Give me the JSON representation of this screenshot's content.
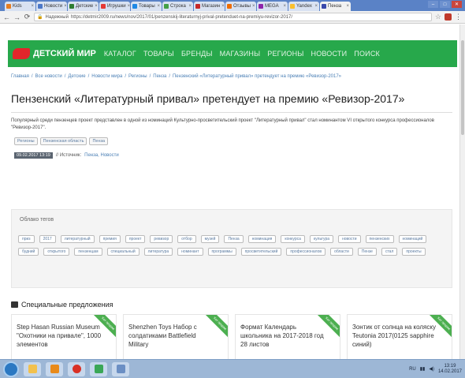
{
  "browser": {
    "tabs": [
      {
        "label": "Kids",
        "color": "#e67e22"
      },
      {
        "label": "Новости",
        "color": "#4c78c8"
      },
      {
        "label": "Детские",
        "color": "#2e7d32"
      },
      {
        "label": "Игрушки",
        "color": "#e53935"
      },
      {
        "label": "Товары",
        "color": "#1e88e5"
      },
      {
        "label": "Строка",
        "color": "#43a047"
      },
      {
        "label": "Магазин",
        "color": "#c62828"
      },
      {
        "label": "Отзывы",
        "color": "#ef6c00"
      },
      {
        "label": "MEGA",
        "color": "#8e24aa"
      },
      {
        "label": "Yandex",
        "color": "#fbc02d"
      },
      {
        "label": "Пенза",
        "color": "#3949ab"
      }
    ],
    "url_prefix": "Надежный",
    "url": "https://detmir2009.ru/news/nov/2017/01/penzenskij-literaturnyj-prival-pretenduet-na-premiyu-revizor-2017/",
    "menu_icon": "⋮"
  },
  "site": {
    "logo": "ДЕТСКИЙ МИР",
    "menu": [
      "КАТАЛОГ",
      "ТОВАРЫ",
      "БРЕНДЫ",
      "МАГАЗИНЫ",
      "РЕГИОНЫ",
      "НОВОСТИ",
      "ПОИСК"
    ]
  },
  "breadcrumbs": [
    "Главная",
    "/",
    "Все новости",
    "/",
    "Детские",
    "/",
    "Новости мира",
    "/",
    "Регионы",
    "/",
    "Пенза",
    "/",
    "Пензенский «Литературный привал» претендует на премию «Ревизор-2017»"
  ],
  "article": {
    "title": "Пензенский «Литературный привал» претендует на премию «Ревизор-2017»",
    "body": "Популярный среди пензенцев проект представлен в одной из номинаций Культурно-просветительский проект \"Литературный привал\" стал номинантом VI открытого конкурса профессионалов \"Ревизор-2017\".",
    "tags": [
      "Регионы",
      "Пензенская область",
      "Пенза"
    ],
    "date": "09.02.2017 13:19",
    "source_label": "// Источник:",
    "source_link": "Пенза, Новости"
  },
  "cloud": {
    "title": "Облако тегов",
    "tags": [
      "приз",
      "2017",
      "литературный",
      "премия",
      "проект",
      "ревизор",
      "отбор",
      "музей",
      "Пенза",
      "номинация",
      "конкурса",
      "культура",
      "новости",
      "пензенских",
      "номинаций",
      "будний",
      "открытого",
      "пензенцам",
      "специальный",
      "литература",
      "номинант",
      "программы",
      "просветительский",
      "профессионалов",
      "области",
      "Пензе",
      "стал",
      "проекты"
    ]
  },
  "special": {
    "title": "Специальные предложения",
    "cards": [
      {
        "name": "Step Hasan Russian Museum \"Охотники на привале\", 1000 элементов",
        "ribbon": "Хит продаж"
      },
      {
        "name": "Shenzhen Toys Набор с солдатиками Battlefield Military",
        "ribbon": "Хит продаж"
      },
      {
        "name": "Формат Календарь школьника на 2017-2018 год 28 листов",
        "ribbon": "Хит продаж"
      },
      {
        "name": "Зонтик от солнца на коляску Teutonia 2017(0125 sapphire синий)",
        "ribbon": "Хит продаж"
      }
    ]
  },
  "taskbar": {
    "lang": "RU",
    "time": "13:19",
    "date": "14.02.2017"
  }
}
